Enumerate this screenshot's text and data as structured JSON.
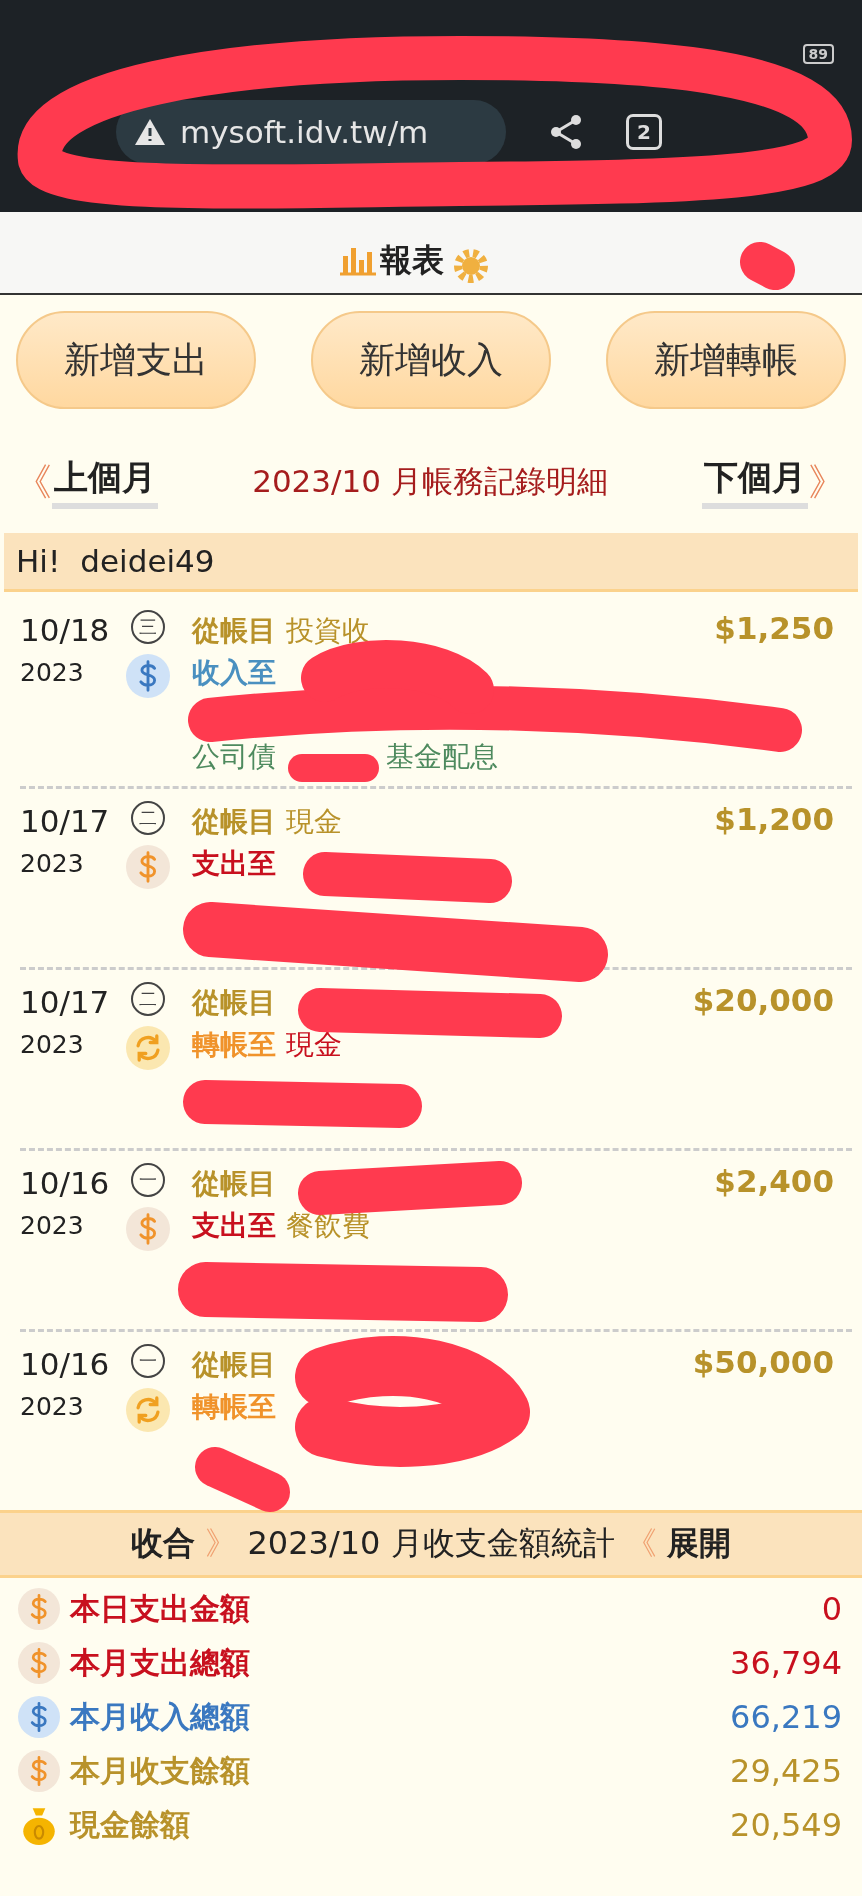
{
  "browser": {
    "url": "mysoft.idv.tw/m",
    "tab_count": "2",
    "battery": "89"
  },
  "nav": [
    {
      "label": "報表",
      "kind": "chart"
    },
    {
      "kind": "gear"
    }
  ],
  "actions": [
    "新增支出",
    "新增收入",
    "新增轉帳"
  ],
  "month_nav": {
    "prev": "上個月",
    "title": "2023/10 月帳務記錄明細",
    "next": "下個月",
    "prev_arrow": "《",
    "next_arrow": "》"
  },
  "greeting": {
    "hi": "Hi!",
    "user": "deidei49"
  },
  "entries": [
    {
      "date": "10/18",
      "year": "2023",
      "weekday": "三",
      "kind": "income",
      "from_label": "從帳目",
      "from": "投資收",
      "to_label": "收入至",
      "memo": [
        "公司債",
        "基金配息"
      ],
      "amount": "$1,250"
    },
    {
      "date": "10/17",
      "year": "2023",
      "weekday": "二",
      "kind": "expense",
      "from_label": "從帳目",
      "from": "現金",
      "to_label": "支出至",
      "amount": "$1,200"
    },
    {
      "date": "10/17",
      "year": "2023",
      "weekday": "二",
      "kind": "transfer",
      "from_label": "從帳目",
      "to_label": "轉帳至",
      "to": "現金",
      "amount": "$20,000"
    },
    {
      "date": "10/16",
      "year": "2023",
      "weekday": "一",
      "kind": "expense",
      "from_label": "從帳目",
      "to_label": "支出至",
      "to": "餐飲費",
      "amount": "$2,400"
    },
    {
      "date": "10/16",
      "year": "2023",
      "weekday": "一",
      "kind": "transfer",
      "from_label": "從帳目",
      "to_label": "轉帳至",
      "amount": "$50,000"
    }
  ],
  "summary_bar": {
    "collapse": "收合",
    "arrow_right": "》",
    "title": "2023/10 月收支金額統計",
    "arrow_left": "《",
    "expand": "展開"
  },
  "summary": [
    {
      "label": "本日支出金額",
      "value": "0",
      "kind": "expense"
    },
    {
      "label": "本月支出總額",
      "value": "36,794",
      "kind": "expense"
    },
    {
      "label": "本月收入總額",
      "value": "66,219",
      "kind": "income"
    },
    {
      "label": "本月收支餘額",
      "value": "29,425",
      "kind": "balance"
    },
    {
      "label": "現金餘額",
      "value": "20,549",
      "kind": "cash"
    }
  ]
}
